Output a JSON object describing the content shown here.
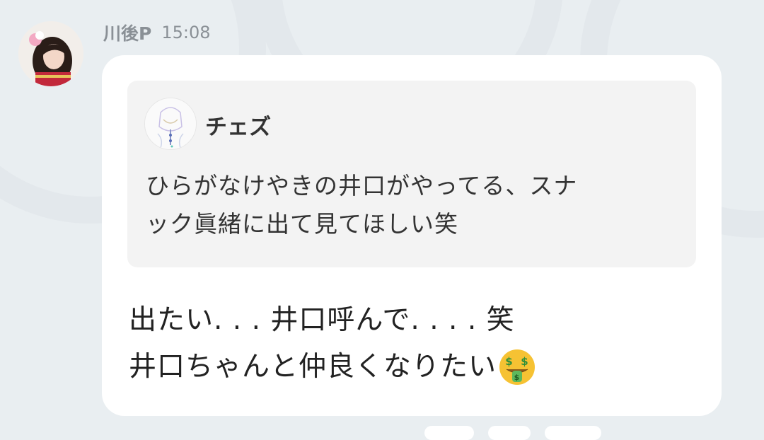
{
  "sender": {
    "name": "川後P",
    "time": "15:08"
  },
  "quote": {
    "author": "チェズ",
    "lines": [
      "ひらがなけやきの井口がやってる、スナ",
      "ック眞緒に出て見てほしい笑"
    ]
  },
  "message": {
    "lines": [
      "出たい. . . 井口呼んで. . . . 笑",
      "井口ちゃんと仲良くなりたい"
    ],
    "emoji": "money-mouth-face-icon"
  },
  "colors": {
    "background": "#e9eef1",
    "bubble": "#ffffff",
    "quote_bg": "#f3f3f3",
    "meta_text": "#8a9096"
  }
}
